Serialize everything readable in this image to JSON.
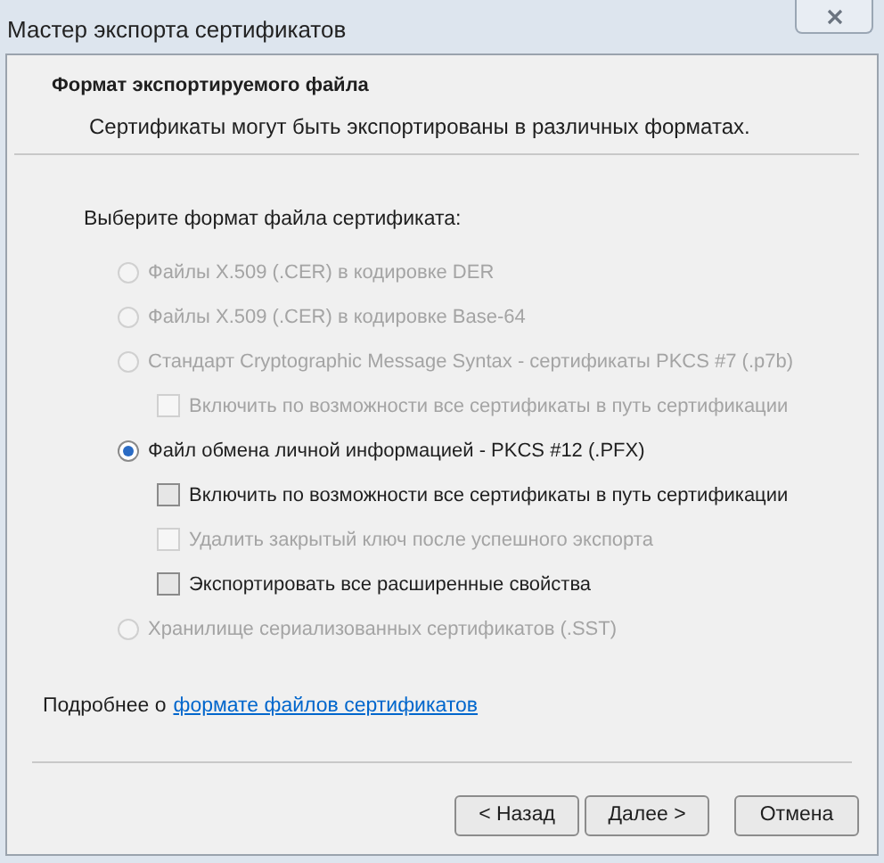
{
  "window": {
    "title": "Мастер экспорта сертификатов"
  },
  "header": {
    "title": "Формат экспортируемого файла",
    "subtitle": "Сертификаты могут быть экспортированы в различных форматах."
  },
  "prompt": "Выберите формат файла сертификата:",
  "options": [
    {
      "label": "Файлы X.509 (.CER) в кодировке DER",
      "selected": false,
      "disabled": true
    },
    {
      "label": "Файлы X.509 (.CER) в кодировке Base-64",
      "selected": false,
      "disabled": true
    },
    {
      "label": "Стандарт Cryptographic Message Syntax - сертификаты PKCS #7 (.p7b)",
      "selected": false,
      "disabled": true,
      "children": [
        {
          "label": "Включить по возможности все сертификаты в путь сертификации",
          "checked": false,
          "disabled": true
        }
      ]
    },
    {
      "label": "Файл обмена личной информацией - PKCS #12 (.PFX)",
      "selected": true,
      "disabled": false,
      "children": [
        {
          "label": "Включить по возможности все сертификаты в путь сертификации",
          "checked": false,
          "disabled": false
        },
        {
          "label": "Удалить закрытый ключ после успешного экспорта",
          "checked": false,
          "disabled": true
        },
        {
          "label": "Экспортировать все расширенные свойства",
          "checked": false,
          "disabled": false
        }
      ]
    },
    {
      "label": "Хранилище сериализованных сертификатов (.SST)",
      "selected": false,
      "disabled": true
    }
  ],
  "more_info": {
    "text": "Подробнее о",
    "link": "формате файлов сертификатов"
  },
  "buttons": [
    {
      "label": "< Назад"
    },
    {
      "label": "Далее >"
    },
    {
      "label": "Отмена"
    }
  ]
}
